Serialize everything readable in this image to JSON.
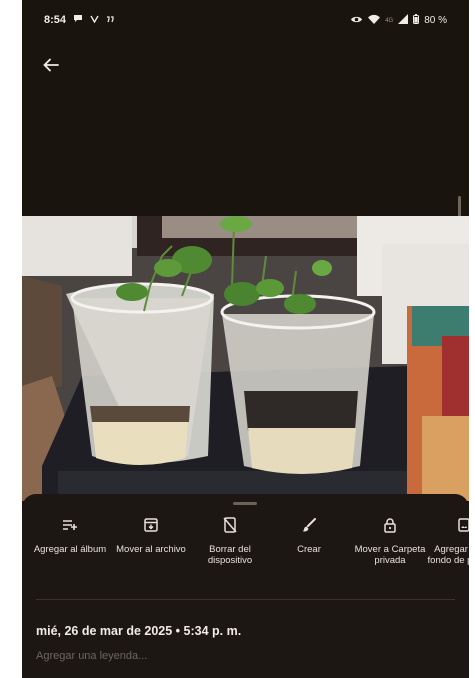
{
  "status_bar": {
    "time": "8:54",
    "signal_label": "4G",
    "battery": "80 %"
  },
  "actions": [
    {
      "label": "Agregar al álbum",
      "icon": "playlist-add-icon"
    },
    {
      "label": "Mover al archivo",
      "icon": "archive-icon"
    },
    {
      "label": "Borrar del dispositivo",
      "icon": "phone-off-icon"
    },
    {
      "label": "Crear",
      "icon": "brush-icon"
    },
    {
      "label": "Mover a Carpeta privada",
      "icon": "lock-icon"
    },
    {
      "label": "Agregar como fondo de pantalla",
      "icon": "wallpaper-icon"
    }
  ],
  "photo_info": {
    "datetime": "mié, 26 de mar de 2025 • 5:34 p. m."
  },
  "caption_input": {
    "placeholder": "Agregar una leyenda..."
  },
  "colors": {
    "background": "#1a140e",
    "sheet": "#1c1712",
    "text": "#e9e2da",
    "muted": "#6d665f"
  }
}
